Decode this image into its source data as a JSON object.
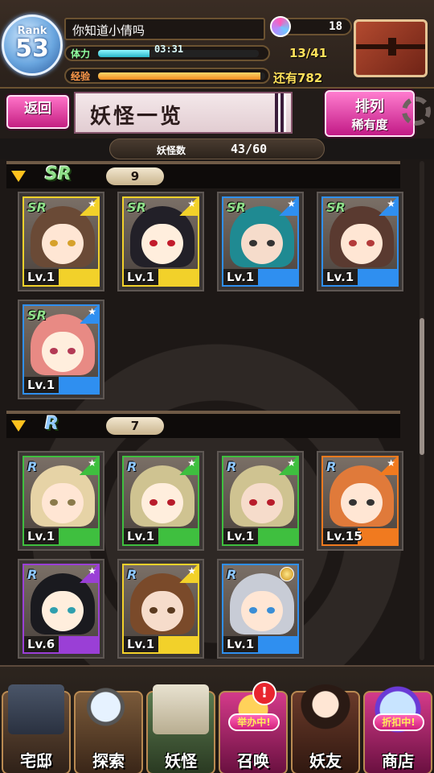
{
  "status": {
    "rank_label": "Rank",
    "rank_value": "53",
    "player_name": "你知道小倩吗",
    "stamina_label": "体力",
    "stamina_timer": "03:31",
    "stamina_value": "13/41",
    "stamina_fraction": 0.32,
    "exp_label": "经验",
    "exp_remaining": "还有782",
    "exp_fraction": 0.97,
    "gems": "18"
  },
  "header": {
    "back_label": "返回",
    "title": "妖怪一览",
    "sort_label": "排列",
    "sort_value": "稀有度"
  },
  "counter": {
    "label": "妖怪数",
    "value": "43/60"
  },
  "sections": [
    {
      "rarity": "SR",
      "count": "9",
      "cards": [
        {
          "level": "Lv.1",
          "bar": "#f2d12a",
          "hair": "#6a4a36",
          "eye": "#d6a12b"
        },
        {
          "level": "Lv.1",
          "bar": "#f2d12a",
          "hair": "#222028",
          "eye": "#c21b2b"
        },
        {
          "level": "Lv.1",
          "bar": "#2f8ff0",
          "hair": "#1f8a92",
          "eye": "#333333"
        },
        {
          "level": "Lv.1",
          "bar": "#2f8ff0",
          "hair": "#5a3a30",
          "eye": "#b33a3a"
        },
        {
          "level": "Lv.1",
          "bar": "#2f8ff0",
          "hair": "#e88a84",
          "eye": "#b33a55"
        }
      ]
    },
    {
      "rarity": "R",
      "count": "7",
      "cards": [
        {
          "level": "Lv.1",
          "bar": "#3fbf3f",
          "hair": "#e6d3a6",
          "eye": "#8a7a4a"
        },
        {
          "level": "Lv.1",
          "bar": "#3fbf3f",
          "hair": "#cfc391",
          "eye": "#b81c2b"
        },
        {
          "level": "Lv.1",
          "bar": "#3fbf3f",
          "hair": "#cfc391",
          "eye": "#b81c2b"
        },
        {
          "level": "Lv.15",
          "bar": "#f07a1f",
          "hair": "#e07a3a",
          "eye": "#333333"
        },
        {
          "level": "Lv.6",
          "bar": "#9a3fd6",
          "hair": "#1a1a1f",
          "eye": "#2f9fae"
        },
        {
          "level": "Lv.1",
          "bar": "#f2d12a",
          "hair": "#7a4a2a",
          "eye": "#5a3a20"
        },
        {
          "level": "Lv.1",
          "bar": "#2f8ff0",
          "hair": "#c8ccd6",
          "eye": "#3a8ed6"
        }
      ]
    }
  ],
  "nav": [
    {
      "label": "宅邸",
      "icon": "house-icon"
    },
    {
      "label": "探索",
      "icon": "magnifier-icon"
    },
    {
      "label": "妖怪",
      "icon": "scroll-icon"
    },
    {
      "label": "召唤",
      "icon": "summon-icon",
      "badge": "举办中!",
      "alert": "!"
    },
    {
      "label": "妖友",
      "icon": "friend-icon"
    },
    {
      "label": "商店",
      "icon": "shop-orb-icon",
      "badge": "折扣中!"
    }
  ],
  "colors": {
    "accent_pink": "#d11f7a",
    "gold": "#ffc21e"
  }
}
